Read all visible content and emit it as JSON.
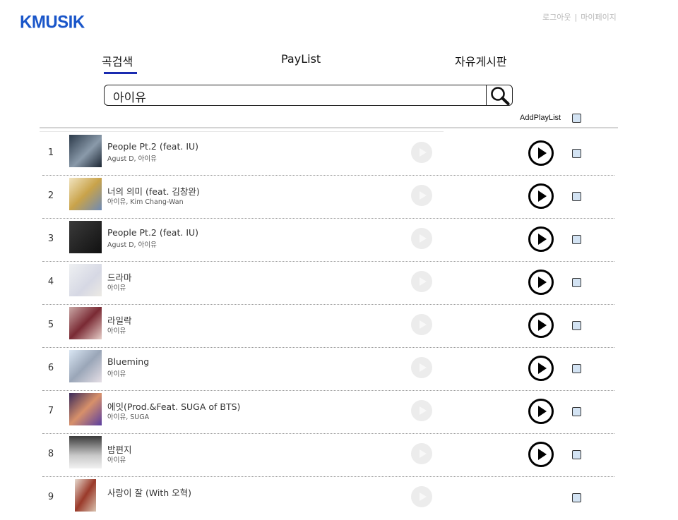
{
  "logo": "KMUSIK",
  "header": {
    "logout": "로그아웃",
    "divider": "|",
    "mypage": "마이페이지"
  },
  "nav": {
    "search": "곡검색",
    "playlist": "PayList",
    "board": "자유게시판"
  },
  "search": {
    "value": "아이유",
    "icon": "magnifier-icon"
  },
  "list_header": {
    "add_playlist": "AddPlayList"
  },
  "songs": [
    {
      "rank": "1",
      "title": "People Pt.2 (feat. IU)",
      "artist": "Agust D, 아이유"
    },
    {
      "rank": "2",
      "title": "너의 의미 (feat. 김창완)",
      "artist": "아이유, Kim Chang-Wan"
    },
    {
      "rank": "3",
      "title": "People Pt.2 (feat. IU)",
      "artist": "Agust D, 아이유"
    },
    {
      "rank": "4",
      "title": "드라마",
      "artist": "아이유"
    },
    {
      "rank": "5",
      "title": "라일락",
      "artist": "아이유"
    },
    {
      "rank": "6",
      "title": "Blueming",
      "artist": "아이유"
    },
    {
      "rank": "7",
      "title": "에잇(Prod.&Feat. SUGA of BTS)",
      "artist": "아이유, SUGA"
    },
    {
      "rank": "8",
      "title": "밤편지",
      "artist": "아이유"
    },
    {
      "rank": "9",
      "title": "사랑이 잘 (With 오혁)",
      "artist": ""
    }
  ],
  "colors": {
    "brand": "#1a56c9",
    "nav_underline": "#1a2bb0",
    "checkbox": "#d3e3f3"
  }
}
